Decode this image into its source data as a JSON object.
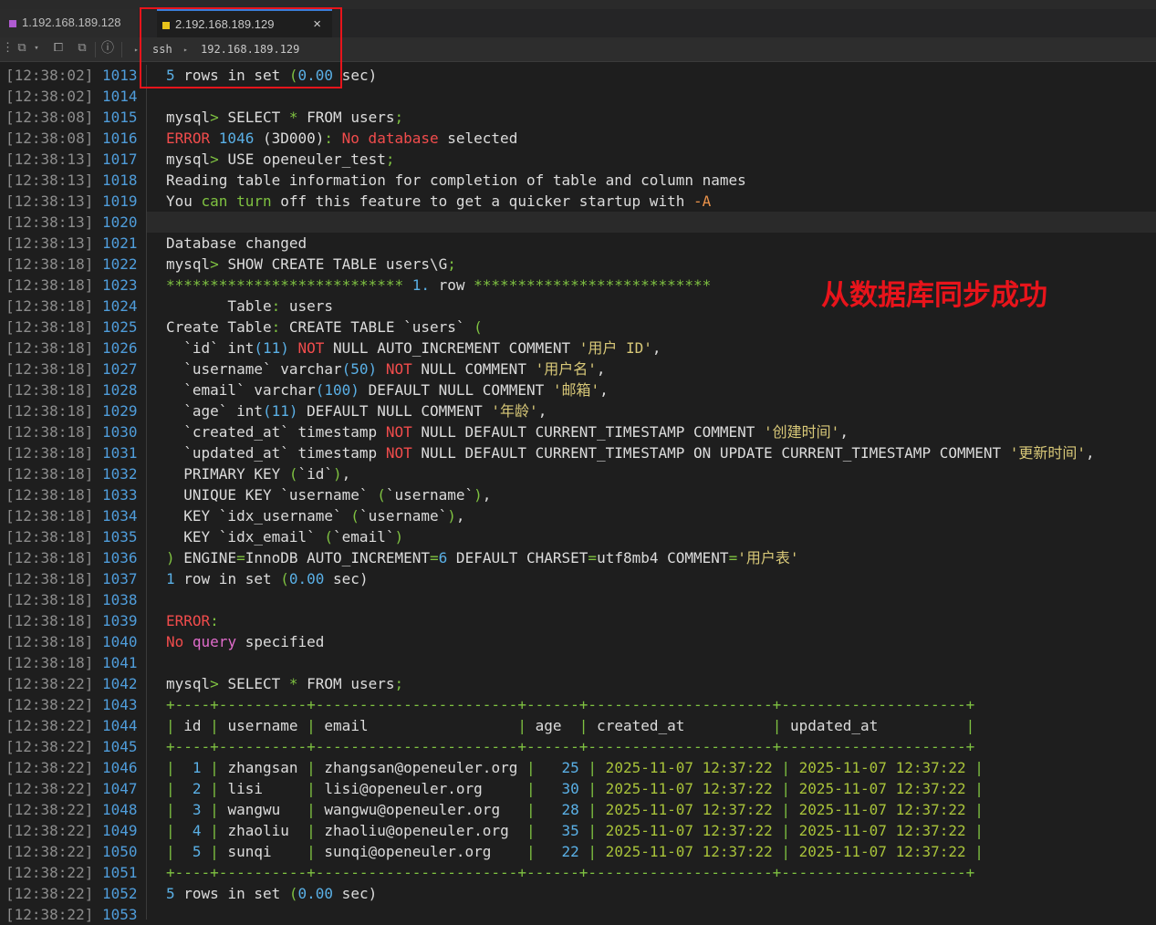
{
  "tabs": [
    {
      "label": "1.192.168.189.128",
      "color": "#b05bd1"
    },
    {
      "label": "2.192.168.189.129",
      "color": "#e8c31b",
      "close": "×"
    }
  ],
  "breadcrumb": {
    "protocol": "ssh",
    "host": "192.168.189.129"
  },
  "annotation": "从数据库同步成功",
  "gutter": [
    {
      "ts": "[12:38:02]",
      "ln": "1013"
    },
    {
      "ts": "[12:38:02]",
      "ln": "1014"
    },
    {
      "ts": "[12:38:08]",
      "ln": "1015"
    },
    {
      "ts": "[12:38:08]",
      "ln": "1016"
    },
    {
      "ts": "[12:38:13]",
      "ln": "1017"
    },
    {
      "ts": "[12:38:13]",
      "ln": "1018"
    },
    {
      "ts": "[12:38:13]",
      "ln": "1019"
    },
    {
      "ts": "[12:38:13]",
      "ln": "1020"
    },
    {
      "ts": "[12:38:13]",
      "ln": "1021"
    },
    {
      "ts": "[12:38:18]",
      "ln": "1022"
    },
    {
      "ts": "[12:38:18]",
      "ln": "1023"
    },
    {
      "ts": "[12:38:18]",
      "ln": "1024"
    },
    {
      "ts": "[12:38:18]",
      "ln": "1025"
    },
    {
      "ts": "[12:38:18]",
      "ln": "1026"
    },
    {
      "ts": "[12:38:18]",
      "ln": "1027"
    },
    {
      "ts": "[12:38:18]",
      "ln": "1028"
    },
    {
      "ts": "[12:38:18]",
      "ln": "1029"
    },
    {
      "ts": "[12:38:18]",
      "ln": "1030"
    },
    {
      "ts": "[12:38:18]",
      "ln": "1031"
    },
    {
      "ts": "[12:38:18]",
      "ln": "1032"
    },
    {
      "ts": "[12:38:18]",
      "ln": "1033"
    },
    {
      "ts": "[12:38:18]",
      "ln": "1034"
    },
    {
      "ts": "[12:38:18]",
      "ln": "1035"
    },
    {
      "ts": "[12:38:18]",
      "ln": "1036"
    },
    {
      "ts": "[12:38:18]",
      "ln": "1037"
    },
    {
      "ts": "[12:38:18]",
      "ln": "1038"
    },
    {
      "ts": "[12:38:18]",
      "ln": "1039"
    },
    {
      "ts": "[12:38:18]",
      "ln": "1040"
    },
    {
      "ts": "[12:38:18]",
      "ln": "1041"
    },
    {
      "ts": "[12:38:22]",
      "ln": "1042"
    },
    {
      "ts": "[12:38:22]",
      "ln": "1043"
    },
    {
      "ts": "[12:38:22]",
      "ln": "1044"
    },
    {
      "ts": "[12:38:22]",
      "ln": "1045"
    },
    {
      "ts": "[12:38:22]",
      "ln": "1046"
    },
    {
      "ts": "[12:38:22]",
      "ln": "1047"
    },
    {
      "ts": "[12:38:22]",
      "ln": "1048"
    },
    {
      "ts": "[12:38:22]",
      "ln": "1049"
    },
    {
      "ts": "[12:38:22]",
      "ln": "1050"
    },
    {
      "ts": "[12:38:22]",
      "ln": "1051"
    },
    {
      "ts": "[12:38:22]",
      "ln": "1052"
    },
    {
      "ts": "[12:38:22]",
      "ln": "1053"
    }
  ],
  "terminal_lines": [
    [
      {
        "t": "5",
        "c": "num"
      },
      {
        "t": " rows in set ",
        "c": "kw"
      },
      {
        "t": "(",
        "c": "green"
      },
      {
        "t": "0.00",
        "c": "num"
      },
      {
        "t": " sec)",
        "c": "kw"
      }
    ],
    [],
    [
      {
        "t": "mysql",
        "c": "kw"
      },
      {
        "t": "> ",
        "c": "green"
      },
      {
        "t": "SELECT ",
        "c": "kw"
      },
      {
        "t": "*",
        "c": "green"
      },
      {
        "t": " FROM users",
        "c": "kw"
      },
      {
        "t": ";",
        "c": "green"
      }
    ],
    [
      {
        "t": "ERROR ",
        "c": "red"
      },
      {
        "t": "1046",
        "c": "num"
      },
      {
        "t": " (3D000)",
        "c": "kw"
      },
      {
        "t": ": ",
        "c": "green"
      },
      {
        "t": "No database",
        "c": "red"
      },
      {
        "t": " selected",
        "c": "kw"
      }
    ],
    [
      {
        "t": "mysql",
        "c": "kw"
      },
      {
        "t": "> ",
        "c": "green"
      },
      {
        "t": "USE openeuler_test",
        "c": "kw"
      },
      {
        "t": ";",
        "c": "green"
      }
    ],
    [
      {
        "t": "Reading table information for completion of table and column names",
        "c": "kw"
      }
    ],
    [
      {
        "t": "You ",
        "c": "kw"
      },
      {
        "t": "can turn",
        "c": "green"
      },
      {
        "t": " off this feature to get a quicker startup with ",
        "c": "kw"
      },
      {
        "t": "-A",
        "c": "orange"
      }
    ],
    [],
    [
      {
        "t": "Database changed",
        "c": "kw"
      }
    ],
    [
      {
        "t": "mysql",
        "c": "kw"
      },
      {
        "t": "> ",
        "c": "green"
      },
      {
        "t": "SHOW CREATE TABLE users\\G",
        "c": "kw"
      },
      {
        "t": ";",
        "c": "green"
      }
    ],
    [
      {
        "t": "***************************",
        "c": "green"
      },
      {
        "t": " 1. ",
        "c": "num"
      },
      {
        "t": "row ",
        "c": "kw"
      },
      {
        "t": "***************************",
        "c": "green"
      }
    ],
    [
      {
        "t": "       Table",
        "c": "kw"
      },
      {
        "t": ": ",
        "c": "green"
      },
      {
        "t": "users",
        "c": "kw"
      }
    ],
    [
      {
        "t": "Create Table",
        "c": "kw"
      },
      {
        "t": ": ",
        "c": "green"
      },
      {
        "t": "CREATE TABLE `users` ",
        "c": "kw"
      },
      {
        "t": "(",
        "c": "green"
      }
    ],
    [
      {
        "t": "  `id` int",
        "c": "kw"
      },
      {
        "t": "(11)",
        "c": "num"
      },
      {
        "t": " NOT",
        "c": "red"
      },
      {
        "t": " NULL AUTO_INCREMENT COMMENT ",
        "c": "kw"
      },
      {
        "t": "'用户 ID'",
        "c": "str"
      },
      {
        "t": ",",
        "c": "kw"
      }
    ],
    [
      {
        "t": "  `username` varchar",
        "c": "kw"
      },
      {
        "t": "(50)",
        "c": "num"
      },
      {
        "t": " NOT",
        "c": "red"
      },
      {
        "t": " NULL COMMENT ",
        "c": "kw"
      },
      {
        "t": "'用户名'",
        "c": "str"
      },
      {
        "t": ",",
        "c": "kw"
      }
    ],
    [
      {
        "t": "  `email` varchar",
        "c": "kw"
      },
      {
        "t": "(100)",
        "c": "num"
      },
      {
        "t": " DEFAULT NULL COMMENT ",
        "c": "kw"
      },
      {
        "t": "'邮箱'",
        "c": "str"
      },
      {
        "t": ",",
        "c": "kw"
      }
    ],
    [
      {
        "t": "  `age` int",
        "c": "kw"
      },
      {
        "t": "(11)",
        "c": "num"
      },
      {
        "t": " DEFAULT NULL COMMENT ",
        "c": "kw"
      },
      {
        "t": "'年龄'",
        "c": "str"
      },
      {
        "t": ",",
        "c": "kw"
      }
    ],
    [
      {
        "t": "  `created_at` timestamp ",
        "c": "kw"
      },
      {
        "t": "NOT",
        "c": "red"
      },
      {
        "t": " NULL DEFAULT CURRENT_TIMESTAMP COMMENT ",
        "c": "kw"
      },
      {
        "t": "'创建时间'",
        "c": "str"
      },
      {
        "t": ",",
        "c": "kw"
      }
    ],
    [
      {
        "t": "  `updated_at` timestamp ",
        "c": "kw"
      },
      {
        "t": "NOT",
        "c": "red"
      },
      {
        "t": " NULL DEFAULT CURRENT_TIMESTAMP ON UPDATE CURRENT_TIMESTAMP COMMENT ",
        "c": "kw"
      },
      {
        "t": "'更新时间'",
        "c": "str"
      },
      {
        "t": ",",
        "c": "kw"
      }
    ],
    [
      {
        "t": "  PRIMARY KEY ",
        "c": "kw"
      },
      {
        "t": "(",
        "c": "green"
      },
      {
        "t": "`id`",
        "c": "kw"
      },
      {
        "t": ")",
        "c": "green"
      },
      {
        "t": ",",
        "c": "kw"
      }
    ],
    [
      {
        "t": "  UNIQUE KEY `username` ",
        "c": "kw"
      },
      {
        "t": "(",
        "c": "green"
      },
      {
        "t": "`username`",
        "c": "kw"
      },
      {
        "t": ")",
        "c": "green"
      },
      {
        "t": ",",
        "c": "kw"
      }
    ],
    [
      {
        "t": "  KEY `idx_username` ",
        "c": "kw"
      },
      {
        "t": "(",
        "c": "green"
      },
      {
        "t": "`username`",
        "c": "kw"
      },
      {
        "t": ")",
        "c": "green"
      },
      {
        "t": ",",
        "c": "kw"
      }
    ],
    [
      {
        "t": "  KEY `idx_email` ",
        "c": "kw"
      },
      {
        "t": "(",
        "c": "green"
      },
      {
        "t": "`email`",
        "c": "kw"
      },
      {
        "t": ")",
        "c": "green"
      }
    ],
    [
      {
        "t": ")",
        "c": "green"
      },
      {
        "t": " ENGINE",
        "c": "kw"
      },
      {
        "t": "=",
        "c": "green"
      },
      {
        "t": "InnoDB AUTO_INCREMENT",
        "c": "kw"
      },
      {
        "t": "=",
        "c": "green"
      },
      {
        "t": "6",
        "c": "num"
      },
      {
        "t": " DEFAULT CHARSET",
        "c": "kw"
      },
      {
        "t": "=",
        "c": "green"
      },
      {
        "t": "utf8mb4 COMMENT",
        "c": "kw"
      },
      {
        "t": "=",
        "c": "green"
      },
      {
        "t": "'用户表'",
        "c": "str"
      }
    ],
    [
      {
        "t": "1",
        "c": "num"
      },
      {
        "t": " row in set ",
        "c": "kw"
      },
      {
        "t": "(",
        "c": "green"
      },
      {
        "t": "0.00",
        "c": "num"
      },
      {
        "t": " sec)",
        "c": "kw"
      }
    ],
    [],
    [
      {
        "t": "ERROR",
        "c": "red"
      },
      {
        "t": ":",
        "c": "green"
      }
    ],
    [
      {
        "t": "No ",
        "c": "red"
      },
      {
        "t": "query",
        "c": "pink"
      },
      {
        "t": " specified",
        "c": "kw"
      }
    ],
    [],
    [
      {
        "t": "mysql",
        "c": "kw"
      },
      {
        "t": "> ",
        "c": "green"
      },
      {
        "t": "SELECT ",
        "c": "kw"
      },
      {
        "t": "*",
        "c": "green"
      },
      {
        "t": " FROM users",
        "c": "kw"
      },
      {
        "t": ";",
        "c": "green"
      }
    ],
    [
      {
        "t": "+----+----------+-----------------------+------+---------------------+---------------------+",
        "c": "green"
      }
    ],
    [
      {
        "t": "|",
        "c": "green"
      },
      {
        "t": " id ",
        "c": "kw"
      },
      {
        "t": "|",
        "c": "green"
      },
      {
        "t": " username ",
        "c": "kw"
      },
      {
        "t": "|",
        "c": "green"
      },
      {
        "t": " email                 ",
        "c": "kw"
      },
      {
        "t": "|",
        "c": "green"
      },
      {
        "t": " age  ",
        "c": "kw"
      },
      {
        "t": "|",
        "c": "green"
      },
      {
        "t": " created_at          ",
        "c": "kw"
      },
      {
        "t": "|",
        "c": "green"
      },
      {
        "t": " updated_at          ",
        "c": "kw"
      },
      {
        "t": "|",
        "c": "green"
      }
    ],
    [
      {
        "t": "+----+----------+-----------------------+------+---------------------+---------------------+",
        "c": "green"
      }
    ],
    [
      {
        "t": "|",
        "c": "green"
      },
      {
        "t": "  1 ",
        "c": "num"
      },
      {
        "t": "|",
        "c": "green"
      },
      {
        "t": " zhangsan ",
        "c": "kw"
      },
      {
        "t": "|",
        "c": "green"
      },
      {
        "t": " zhangsan@openeuler.org ",
        "c": "kw"
      },
      {
        "t": "|",
        "c": "green"
      },
      {
        "t": "   25 ",
        "c": "num"
      },
      {
        "t": "|",
        "c": "green"
      },
      {
        "t": " 2025-11-07 12:37:22 ",
        "c": "yg"
      },
      {
        "t": "|",
        "c": "green"
      },
      {
        "t": " 2025-11-07 12:37:22 ",
        "c": "yg"
      },
      {
        "t": "|",
        "c": "green"
      }
    ],
    [
      {
        "t": "|",
        "c": "green"
      },
      {
        "t": "  2 ",
        "c": "num"
      },
      {
        "t": "|",
        "c": "green"
      },
      {
        "t": " lisi     ",
        "c": "kw"
      },
      {
        "t": "|",
        "c": "green"
      },
      {
        "t": " lisi@openeuler.org     ",
        "c": "kw"
      },
      {
        "t": "|",
        "c": "green"
      },
      {
        "t": "   30 ",
        "c": "num"
      },
      {
        "t": "|",
        "c": "green"
      },
      {
        "t": " 2025-11-07 12:37:22 ",
        "c": "yg"
      },
      {
        "t": "|",
        "c": "green"
      },
      {
        "t": " 2025-11-07 12:37:22 ",
        "c": "yg"
      },
      {
        "t": "|",
        "c": "green"
      }
    ],
    [
      {
        "t": "|",
        "c": "green"
      },
      {
        "t": "  3 ",
        "c": "num"
      },
      {
        "t": "|",
        "c": "green"
      },
      {
        "t": " wangwu   ",
        "c": "kw"
      },
      {
        "t": "|",
        "c": "green"
      },
      {
        "t": " wangwu@openeuler.org   ",
        "c": "kw"
      },
      {
        "t": "|",
        "c": "green"
      },
      {
        "t": "   28 ",
        "c": "num"
      },
      {
        "t": "|",
        "c": "green"
      },
      {
        "t": " 2025-11-07 12:37:22 ",
        "c": "yg"
      },
      {
        "t": "|",
        "c": "green"
      },
      {
        "t": " 2025-11-07 12:37:22 ",
        "c": "yg"
      },
      {
        "t": "|",
        "c": "green"
      }
    ],
    [
      {
        "t": "|",
        "c": "green"
      },
      {
        "t": "  4 ",
        "c": "num"
      },
      {
        "t": "|",
        "c": "green"
      },
      {
        "t": " zhaoliu  ",
        "c": "kw"
      },
      {
        "t": "|",
        "c": "green"
      },
      {
        "t": " zhaoliu@openeuler.org  ",
        "c": "kw"
      },
      {
        "t": "|",
        "c": "green"
      },
      {
        "t": "   35 ",
        "c": "num"
      },
      {
        "t": "|",
        "c": "green"
      },
      {
        "t": " 2025-11-07 12:37:22 ",
        "c": "yg"
      },
      {
        "t": "|",
        "c": "green"
      },
      {
        "t": " 2025-11-07 12:37:22 ",
        "c": "yg"
      },
      {
        "t": "|",
        "c": "green"
      }
    ],
    [
      {
        "t": "|",
        "c": "green"
      },
      {
        "t": "  5 ",
        "c": "num"
      },
      {
        "t": "|",
        "c": "green"
      },
      {
        "t": " sunqi    ",
        "c": "kw"
      },
      {
        "t": "|",
        "c": "green"
      },
      {
        "t": " sunqi@openeuler.org    ",
        "c": "kw"
      },
      {
        "t": "|",
        "c": "green"
      },
      {
        "t": "   22 ",
        "c": "num"
      },
      {
        "t": "|",
        "c": "green"
      },
      {
        "t": " 2025-11-07 12:37:22 ",
        "c": "yg"
      },
      {
        "t": "|",
        "c": "green"
      },
      {
        "t": " 2025-11-07 12:37:22 ",
        "c": "yg"
      },
      {
        "t": "|",
        "c": "green"
      }
    ],
    [
      {
        "t": "+----+----------+-----------------------+------+---------------------+---------------------+",
        "c": "green"
      }
    ],
    [
      {
        "t": "5",
        "c": "num"
      },
      {
        "t": " rows in set ",
        "c": "kw"
      },
      {
        "t": "(",
        "c": "green"
      },
      {
        "t": "0.00",
        "c": "num"
      },
      {
        "t": " sec)",
        "c": "kw"
      }
    ]
  ]
}
